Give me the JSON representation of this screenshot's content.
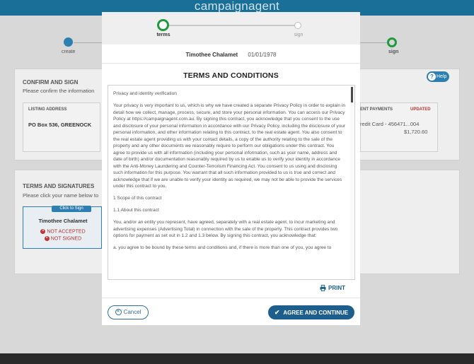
{
  "app": {
    "brand": "campaignagent"
  },
  "background": {
    "steps": {
      "left_label": "create",
      "right_label": "sign"
    },
    "confirm": {
      "title": "CONFIRM AND SIGN",
      "subtitle": "Please confirm the information",
      "listing_address_header": "LISTING ADDRESS",
      "listing_address": "PO Box 536, GREENOCK",
      "payments_header": "ENT PAYMENTS",
      "updated_badge": "UPDATED",
      "card_text": "redit Card - 456471...004",
      "amount": "$1,720.60",
      "help": "Help"
    },
    "signatures": {
      "title": "TERMS AND SIGNATURES",
      "subtitle": "Please click your name below to",
      "click_to_sign": "Click to Sign",
      "signer_name": "Timothee Chalamet",
      "status_1": "NOT ACCEPTED",
      "status_2": "NOT SIGNED"
    }
  },
  "modal": {
    "progress": {
      "step1": "terms",
      "step2": "sign"
    },
    "signer": {
      "name": "Timothee Chalamet",
      "dob": "01/01/1978"
    },
    "title": "TERMS AND CONDITIONS",
    "terms": [
      "Privacy and identity verification",
      "Your privacy is very important to us, which is why we have created a separate Privacy Policy in order to explain in detail how we collect, manage, process, secure, and store your personal information. You can access our Privacy Policy at https://campaignagent.com.au. By signing this contract, you acknowledge that you consent to the use and disclosure of your personal information in accordance with our Privacy Policy, including the disclosure of your personal information, and other information relating to this contract, to the real estate agent. You also consent to the real estate agent providing us with your contact details, a copy of the authority relating to the sale of the property and any other documents we reasonably require to perform our obligations under this contract. You agree to provide us with all information (including your personal information, such as your name, address and date of birth) and/or documentation reasonably required by us to enable us to verify your identity in accordance with the Anti-Money Laundering and Counter-Terrorism Financing Act. You consent to us using and disclosing such information for this purpose. You warrant that all such information provided to us is true and correct and acknowledge that if we are unable to verify your identity as required, we may not be able to provide the services under this contract to you.",
      "1 Scope of this contract",
      "1.1 About this contract",
      "You, and/or an entity you represent, have agreed, separately with a real estate agent, to incur marketing and advertising expenses (Advertising Total) in connection with the sale of the property. This contract provides two options for payment as set out in 1.2 and 1.3 below. By signing this contract, you acknowledge that:",
      "a. you agree to be bound by these terms and conditions and, if there is more than one of you, you agree to"
    ],
    "print_label": "PRINT",
    "cancel_label": "Cancel",
    "agree_label": "AGREE AND CONTINUE"
  }
}
